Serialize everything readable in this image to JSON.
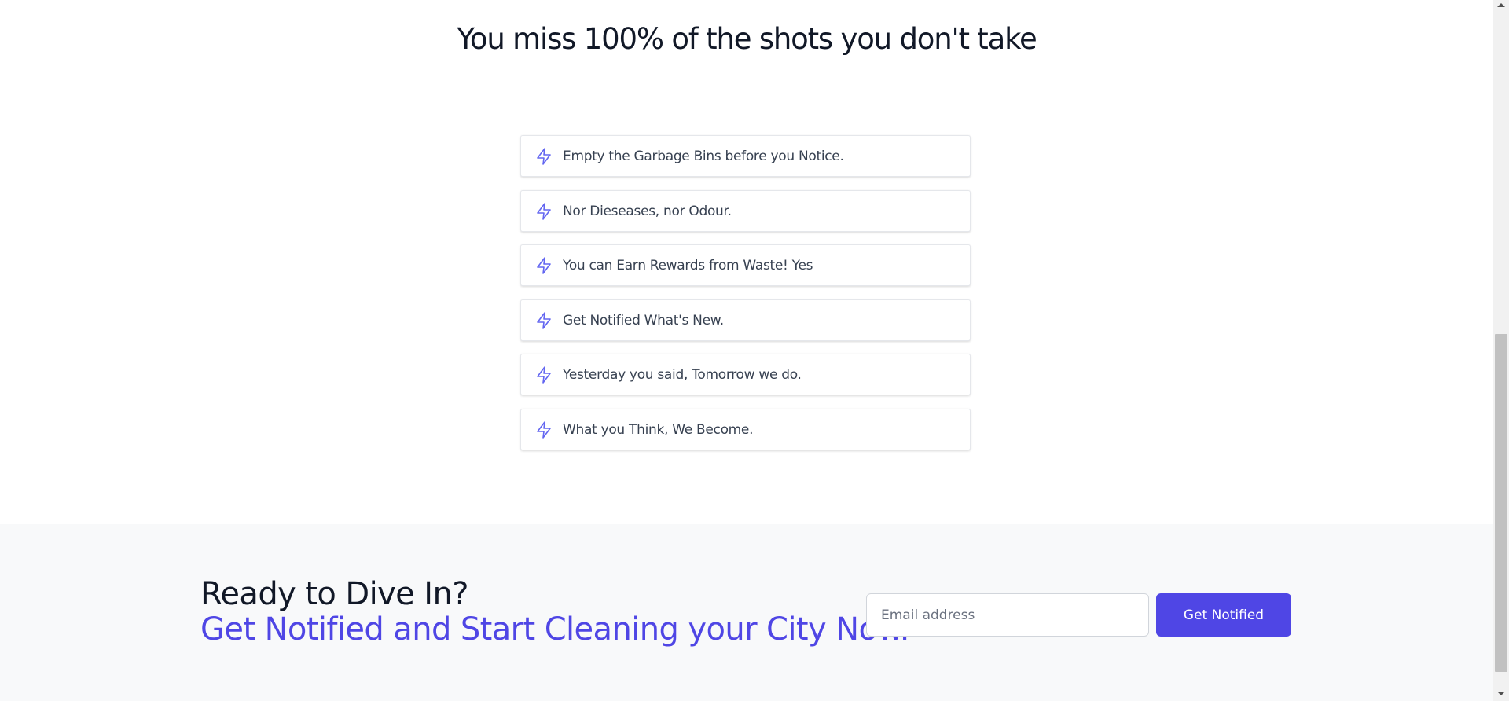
{
  "heading": "You miss 100% of the shots you don't take",
  "features": {
    "icon": "lightning-bolt-icon",
    "items": [
      {
        "label": "Empty the Garbage Bins before you Notice."
      },
      {
        "label": "Nor Dieseases, nor Odour."
      },
      {
        "label": "You can Earn Rewards from Waste! Yes"
      },
      {
        "label": "Get Notified What's New."
      },
      {
        "label": "Yesterday you said, Tomorrow we do."
      },
      {
        "label": "What you Think, We Become."
      }
    ]
  },
  "cta": {
    "title": "Ready to Dive In?",
    "subtitle": "Get Notified and Start Cleaning your City Now.",
    "email_placeholder": "Email address",
    "email_value": "",
    "button_label": "Get Notified"
  },
  "colors": {
    "accent": "#4f46e5",
    "icon": "#6366f1",
    "cta_background": "#f8f9fa"
  }
}
